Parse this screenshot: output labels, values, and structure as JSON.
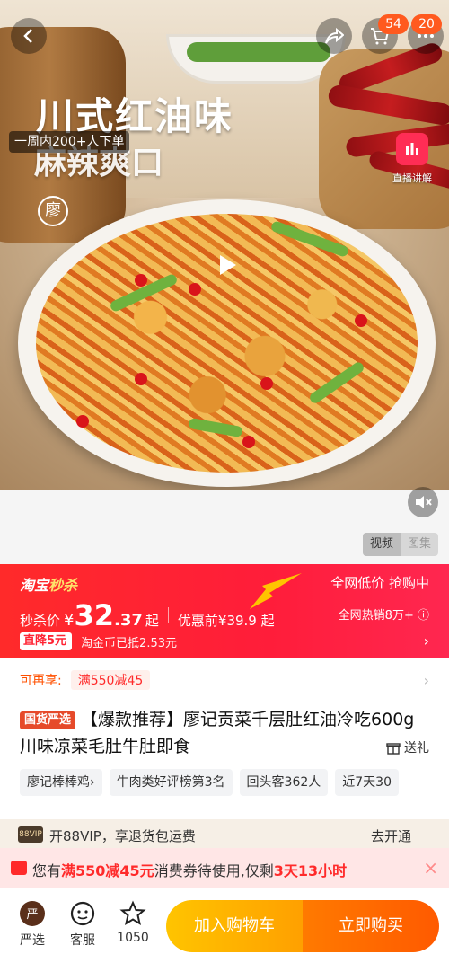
{
  "hero": {
    "headline": "川式红油味",
    "subline": "麻辣爽口",
    "order_pill": "一周内200+人下单",
    "live_label": "直播讲解"
  },
  "top": {
    "share_count": "54",
    "cart_count": "20"
  },
  "media_toggle": {
    "video_label": "视频",
    "image_label": "图集"
  },
  "sale": {
    "brand_a": "淘宝",
    "brand_b": "秒杀",
    "price_label": "秒杀价",
    "currency": "¥",
    "price_int": "32",
    "price_dec": ".37",
    "price_suffix": "起",
    "before_label": "优惠前¥39.9 起",
    "cut_label": "直降5元",
    "coin_label": "淘金币已抵2.53元",
    "right_top": "全网低价 抢购中",
    "right_mid": "全网热销8万+",
    "right_chev": "›"
  },
  "card": {
    "again_label": "可再享:",
    "coupon_label": "满550减45",
    "guo_tag": "国货严选",
    "title": "【爆款推荐】廖记贡菜千层肚红油冷吃600g川味凉菜毛肚牛肚即食",
    "gift_label": "送礼",
    "chips": [
      "廖记棒棒鸡›",
      "牛肉类好评榜第3名",
      "回头客362人",
      "近7天30"
    ]
  },
  "vip": {
    "tag": "88VIP",
    "text": "开88VIP，享退货包运费",
    "go": "去开通"
  },
  "notice": {
    "pre": "您有",
    "coupon": "满550减45元",
    "mid": "消费券待使用,仅剩",
    "time": "3天13小时",
    "close": "×"
  },
  "bottom": {
    "tab1": "严选",
    "tab2": "客服",
    "tab3": "1050",
    "add_cart": "加入购物车",
    "buy_now": "立即购买"
  }
}
